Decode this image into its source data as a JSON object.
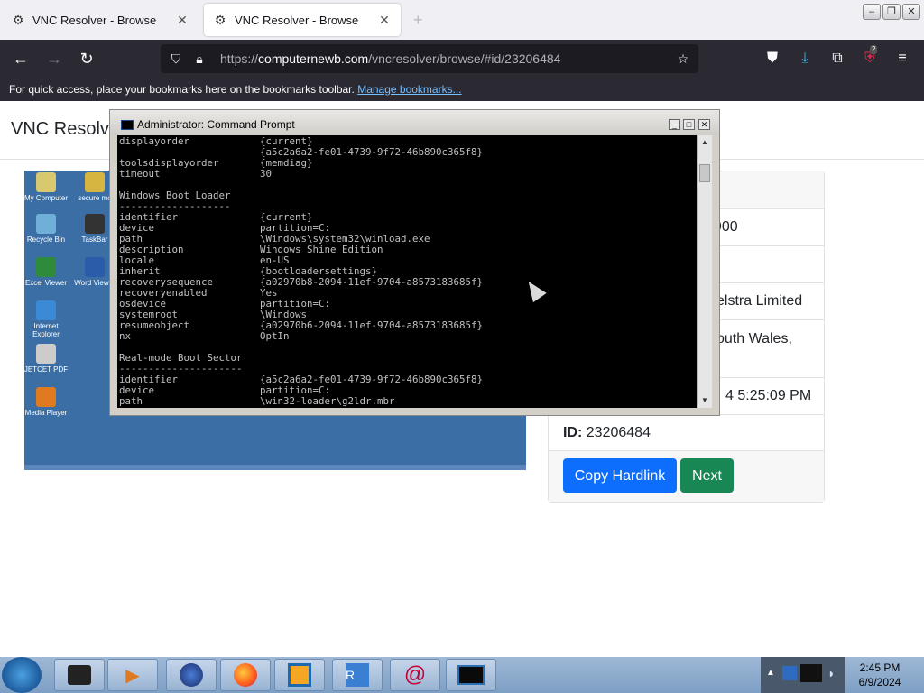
{
  "browser": {
    "tabs": [
      {
        "label": "VNC Resolver - Browse",
        "active": false
      },
      {
        "label": "VNC Resolver - Browse",
        "active": true
      }
    ],
    "url_prefix": "https://",
    "url_host": "computernewb.com",
    "url_path": "/vncresolver/browse/#id/23206484",
    "bookmarks_text": "For quick access, place your bookmarks here on the bookmarks toolbar.",
    "bookmarks_link": "Manage bookmarks...",
    "extension_badge": "2"
  },
  "page": {
    "title": "VNC Resolve",
    "card_rows": [
      {
        "text": "900"
      },
      {
        "text": ""
      },
      {
        "text": "elstra Limited"
      },
      {
        "text": "outh Wales,"
      },
      {
        "text": "4 5:25:09 PM"
      }
    ],
    "id_label": "ID:",
    "id_value": "23206484",
    "copy_button": "Copy Hardlink",
    "next_button": "Next"
  },
  "remote_desktop": {
    "icons": [
      {
        "label": "My Computer",
        "color": "#d8c870"
      },
      {
        "label": "secure mo",
        "color": "#d6b640"
      },
      {
        "label": "Recycle Bin",
        "color": "#6fb0d8"
      },
      {
        "label": "TaskBar",
        "color": "#333333"
      },
      {
        "label": "Excel Viewer",
        "color": "#2e8b3c"
      },
      {
        "label": "Word Viewer",
        "color": "#2a5caa"
      },
      {
        "label": "Internet Explorer",
        "color": "#3a8ad6"
      },
      {
        "label": "JETCET PDF",
        "color": "#cccccc"
      },
      {
        "label": "Media Player",
        "color": "#e07a20"
      }
    ]
  },
  "cmd": {
    "title": "Administrator: Command Prompt",
    "lines": [
      "displayorder            {current}",
      "                        {a5c2a6a2-fe01-4739-9f72-46b890c365f8}",
      "toolsdisplayorder       {memdiag}",
      "timeout                 30",
      "",
      "Windows Boot Loader",
      "-------------------",
      "identifier              {current}",
      "device                  partition=C:",
      "path                    \\Windows\\system32\\winload.exe",
      "description             Windows Shine Edition",
      "locale                  en-US",
      "inherit                 {bootloadersettings}",
      "recoverysequence        {a02970b8-2094-11ef-9704-a8573183685f}",
      "recoveryenabled         Yes",
      "osdevice                partition=C:",
      "systemroot              \\Windows",
      "resumeobject            {a02970b6-2094-11ef-9704-a8573183685f}",
      "nx                      OptIn",
      "",
      "Real-mode Boot Sector",
      "---------------------",
      "identifier              {a5c2a6a2-fe01-4739-9f72-46b890c365f8}",
      "device                  partition=C:",
      "path                    \\win32-loader\\g2ldr.mbr"
    ]
  },
  "taskbar": {
    "time": "2:45 PM",
    "date": "6/9/2024",
    "items": [
      "terminal-box",
      "media-player",
      "globe",
      "firefox",
      "virtualbox",
      "remote-desktop",
      "debian",
      "display"
    ]
  }
}
